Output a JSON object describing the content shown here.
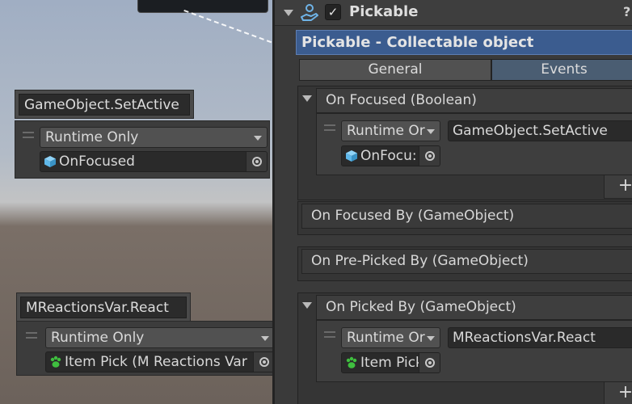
{
  "scene": {
    "node1": {
      "title": "GameObject.SetActive",
      "mode": "Runtime Only",
      "target": "OnFocused",
      "target_icon": "cube-icon"
    },
    "node2": {
      "title": "MReactionsVar.React",
      "mode": "Runtime Only",
      "target": "Item Pick (M Reactions Var",
      "target_icon": "paw-icon"
    }
  },
  "inspector": {
    "component_title": "Pickable",
    "component_enabled": true,
    "checkmark": "✓",
    "help_label": "?",
    "banner": "Pickable - Collectable object",
    "tabs": [
      "General",
      "Events"
    ],
    "active_tab": "Events",
    "plus_label": "+",
    "events": [
      {
        "name": "On Focused (Boolean)",
        "expanded": true,
        "listener": {
          "mode": "Runtime Or",
          "method": "GameObject.SetActive",
          "target": "OnFocu:",
          "target_icon": "cube-icon"
        }
      },
      {
        "name": "On Focused By (GameObject)",
        "expanded": false
      },
      {
        "name": "On Pre-Picked By (GameObject)",
        "expanded": false
      },
      {
        "name": "On Picked By (GameObject)",
        "expanded": true,
        "listener": {
          "mode": "Runtime Or",
          "method": "MReactionsVar.React",
          "target": "Item Pick",
          "target_icon": "paw-icon"
        }
      }
    ]
  },
  "colors": {
    "banner_bg": "#3b5c8f",
    "active_tab_bg": "#4a5d72",
    "cube_icon": "#5fb8ea",
    "paw_icon": "#3fbf3f"
  }
}
